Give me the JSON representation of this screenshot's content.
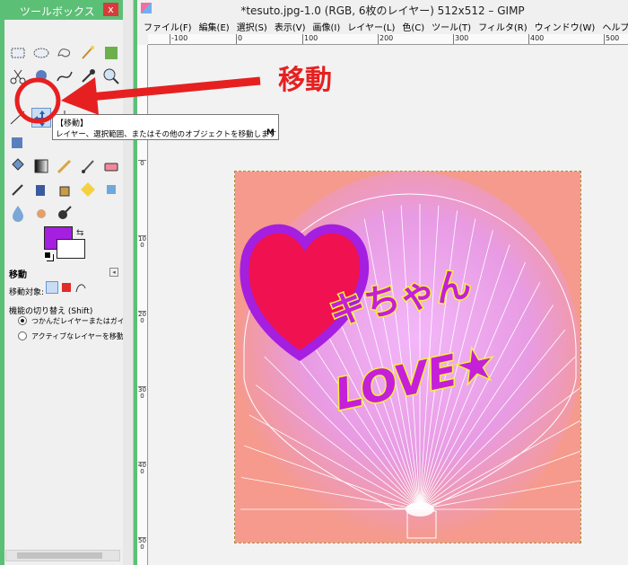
{
  "toolbox": {
    "title": "ツールボックス",
    "close": "x",
    "fg_color": "#a51fe0",
    "bg_color": "#ffffff",
    "options_title": "移動",
    "move_target_label": "移動対象:",
    "mode_label": "機能の切り替え (Shift)",
    "radio_1": "つかんだレイヤーまたはガイドを移",
    "radio_2": "アクティブなレイヤーを移動"
  },
  "tooltip": {
    "title": "【移動】",
    "desc": "レイヤー、選択範囲、またはその他のオブジェクトを移動します",
    "key": "M"
  },
  "image_window": {
    "title": "*tesuto.jpg-1.0 (RGB, 6枚のレイヤー) 512x512 – GIMP",
    "menus": [
      "ファイル(F)",
      "編集(E)",
      "選択(S)",
      "表示(V)",
      "画像(I)",
      "レイヤー(L)",
      "色(C)",
      "ツール(T)",
      "フィルタ(R)",
      "ウィンドウ(W)",
      "ヘルプ(H)"
    ],
    "ruler_top": [
      "-100",
      "0",
      "100",
      "200",
      "300",
      "400",
      "500"
    ],
    "ruler_left": [
      "0",
      "100",
      "200",
      "300",
      "400",
      "500"
    ]
  },
  "canvas": {
    "line1": "キちゃん",
    "line2": "LOVE★",
    "text_color": "#c51fd9",
    "heart_color": "#f01150",
    "bg_color": "#f59a8c"
  },
  "annotation": {
    "label": "移動",
    "color": "#e62020"
  }
}
